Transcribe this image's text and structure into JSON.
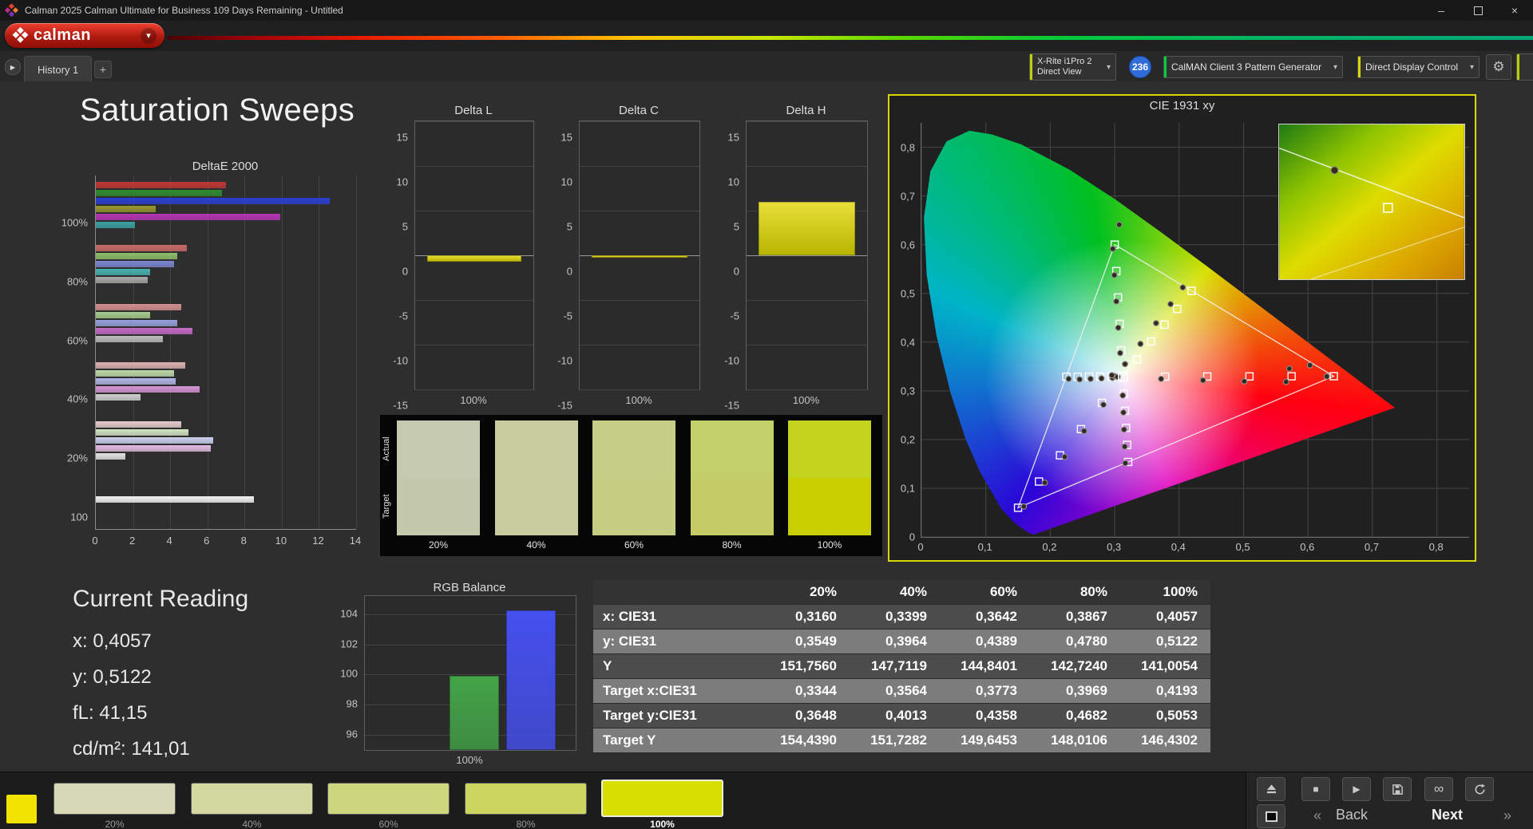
{
  "window": {
    "title": "Calman 2025 Calman Ultimate for Business 109 Days Remaining  - Untitled",
    "controls": {
      "minimize": "–",
      "close": "×"
    }
  },
  "brand": {
    "name": "calman",
    "menu_arrow": "▾"
  },
  "tabs": {
    "collapse": "▶",
    "history": "History 1",
    "add": "+"
  },
  "devices": {
    "meter": {
      "line1": "X-Rite i1Pro 2",
      "line2": "Direct View",
      "arrow": "▾",
      "accent": "#bfd100"
    },
    "badge": "236",
    "source": {
      "label": "CalMAN Client 3 Pattern Generator",
      "arrow": "▾",
      "accent": "#00d23c"
    },
    "display": {
      "label": "Direct Display Control",
      "arrow": "▾",
      "accent": "#d6d800"
    },
    "settings_icon": "⚙"
  },
  "page": {
    "title": "Saturation Sweeps"
  },
  "icons": {
    "stop": "■",
    "play": "▶",
    "infinity": "∞",
    "back_chevron": "«",
    "next_chevron": "»"
  },
  "charts": {
    "deltae": {
      "type": "bar",
      "title": "DeltaE 2000",
      "xlabel": "",
      "ylabel": "",
      "xlim": [
        0,
        14
      ],
      "xticks": [
        0,
        2,
        4,
        6,
        8,
        10,
        12,
        14
      ],
      "groups": [
        {
          "label": "100%",
          "bars": [
            {
              "color": "#c03636",
              "value": 7.0
            },
            {
              "color": "#2f8b2f",
              "value": 6.8
            },
            {
              "color": "#2b3fd0",
              "value": 12.6
            },
            {
              "color": "#96962e",
              "value": 3.2
            },
            {
              "color": "#b535b5",
              "value": 9.9
            },
            {
              "color": "#3aa0a0",
              "value": 2.1
            }
          ]
        },
        {
          "label": "80%",
          "bars": [
            {
              "color": "#cc6a6a",
              "value": 4.9
            },
            {
              "color": "#8fbf6a",
              "value": 4.4
            },
            {
              "color": "#7a86d0",
              "value": 4.2
            },
            {
              "color": "#49b0b0",
              "value": 2.9
            },
            {
              "color": "#a8a8a8",
              "value": 2.8
            }
          ]
        },
        {
          "label": "60%",
          "bars": [
            {
              "color": "#d29090",
              "value": 4.6
            },
            {
              "color": "#a6cc8d",
              "value": 2.9
            },
            {
              "color": "#97a0dd",
              "value": 4.4
            },
            {
              "color": "#c46ac4",
              "value": 5.2
            },
            {
              "color": "#bcbcbc",
              "value": 3.6
            }
          ]
        },
        {
          "label": "40%",
          "bars": [
            {
              "color": "#dcb0b0",
              "value": 4.8
            },
            {
              "color": "#bcd8a8",
              "value": 4.2
            },
            {
              "color": "#b0b6e6",
              "value": 4.3
            },
            {
              "color": "#d494d4",
              "value": 5.6
            },
            {
              "color": "#cfcfcf",
              "value": 2.4
            }
          ]
        },
        {
          "label": "20%",
          "bars": [
            {
              "color": "#e6cccc",
              "value": 4.6
            },
            {
              "color": "#d2e6c4",
              "value": 5.0
            },
            {
              "color": "#ccd0ee",
              "value": 6.3
            },
            {
              "color": "#e2bce2",
              "value": 6.2
            },
            {
              "color": "#e3e3e3",
              "value": 1.6
            }
          ]
        },
        {
          "label": "100",
          "bars": [
            {
              "color": "#f2f2f2",
              "value": 8.5
            }
          ]
        }
      ]
    },
    "delta_l": {
      "type": "bar",
      "title": "Delta L",
      "value": -0.7,
      "ylim": [
        -15,
        15
      ],
      "yticks": [
        15,
        10,
        5,
        0,
        -5,
        -10,
        -15
      ],
      "xlabel": "100%",
      "bar_color": "#d6d200"
    },
    "delta_c": {
      "type": "bar",
      "title": "Delta C",
      "value": -0.3,
      "ylim": [
        -15,
        15
      ],
      "yticks": [
        15,
        10,
        5,
        0,
        -5,
        -10,
        -15
      ],
      "xlabel": "100%",
      "bar_color": "#d6d200"
    },
    "delta_h": {
      "type": "bar",
      "title": "Delta H",
      "value": 6.0,
      "ylim": [
        -15,
        15
      ],
      "yticks": [
        15,
        10,
        5,
        0,
        -5,
        -10,
        -15
      ],
      "xlabel": "100%",
      "bar_color": "#d6d200"
    },
    "swatch_compare": {
      "row_labels": [
        "Actual",
        "Target"
      ],
      "columns": [
        "20%",
        "40%",
        "60%",
        "80%",
        "100%"
      ],
      "actual": [
        "#c6cab1",
        "#c8cda0",
        "#c4ce84",
        "#c3cf6b",
        "#c4d41e"
      ],
      "target": [
        "#c5c9ac",
        "#c9cc9c",
        "#c6cc82",
        "#c5cc66",
        "#c9cf00"
      ]
    },
    "rgb_balance": {
      "type": "bar",
      "title": "RGB Balance",
      "ylim": [
        95,
        105.2
      ],
      "yticks": [
        104,
        102,
        100,
        98,
        96
      ],
      "xlabel": "100%",
      "bars": [
        {
          "name": "green",
          "value": 99.9,
          "color": "#43a447"
        },
        {
          "name": "blue",
          "value": 104.25,
          "color": "#4550ef"
        }
      ]
    },
    "cie": {
      "type": "scatter",
      "title": "CIE 1931 xy",
      "xmax": 0.85,
      "ymax": 0.85,
      "ticks": [
        0,
        0.1,
        0.2,
        0.3,
        0.4,
        0.5,
        0.6,
        0.7,
        0.8
      ],
      "tick_labels": [
        "0",
        "0,1",
        "0,2",
        "0,3",
        "0,4",
        "0,5",
        "0,6",
        "0,7",
        "0,8"
      ],
      "white_point": [
        0.3127,
        0.329
      ],
      "triangle": [
        [
          0.64,
          0.33
        ],
        [
          0.3,
          0.6
        ],
        [
          0.15,
          0.06
        ]
      ],
      "locus": [
        [
          0.1741,
          0.005
        ],
        [
          0.166,
          0.009
        ],
        [
          0.1566,
          0.0177
        ],
        [
          0.144,
          0.0297
        ],
        [
          0.1241,
          0.0578
        ],
        [
          0.0913,
          0.1327
        ],
        [
          0.0687,
          0.2007
        ],
        [
          0.0454,
          0.295
        ],
        [
          0.0235,
          0.4127
        ],
        [
          0.0082,
          0.5384
        ],
        [
          0.0039,
          0.6548
        ],
        [
          0.0139,
          0.7502
        ],
        [
          0.0389,
          0.812
        ],
        [
          0.0743,
          0.8338
        ],
        [
          0.1096,
          0.8262
        ],
        [
          0.1547,
          0.8059
        ],
        [
          0.2296,
          0.7543
        ],
        [
          0.3016,
          0.6923
        ],
        [
          0.3731,
          0.6245
        ],
        [
          0.4441,
          0.5547
        ],
        [
          0.5125,
          0.4866
        ],
        [
          0.5752,
          0.4242
        ],
        [
          0.627,
          0.3725
        ],
        [
          0.6658,
          0.334
        ],
        [
          0.6915,
          0.3083
        ],
        [
          0.7079,
          0.292
        ],
        [
          0.7347,
          0.2653
        ]
      ],
      "target_squares": [
        [
          0.3782,
          0.3292
        ],
        [
          0.4436,
          0.3294
        ],
        [
          0.5091,
          0.3296
        ],
        [
          0.5745,
          0.3298
        ],
        [
          0.64,
          0.33
        ],
        [
          0.3102,
          0.3832
        ],
        [
          0.3076,
          0.4374
        ],
        [
          0.3051,
          0.4916
        ],
        [
          0.3025,
          0.5458
        ],
        [
          0.3,
          0.6
        ],
        [
          0.2802,
          0.2752
        ],
        [
          0.2476,
          0.2214
        ],
        [
          0.2151,
          0.1676
        ],
        [
          0.1825,
          0.1138
        ],
        [
          0.15,
          0.06
        ],
        [
          0.3344,
          0.3648
        ],
        [
          0.3564,
          0.4013
        ],
        [
          0.3773,
          0.4358
        ],
        [
          0.3969,
          0.4682
        ],
        [
          0.4193,
          0.5053
        ],
        [
          0.2952,
          0.329
        ],
        [
          0.2776,
          0.329
        ],
        [
          0.2601,
          0.329
        ],
        [
          0.2425,
          0.329
        ],
        [
          0.225,
          0.329
        ],
        [
          0.3143,
          0.294
        ],
        [
          0.316,
          0.259
        ],
        [
          0.3176,
          0.224
        ],
        [
          0.3193,
          0.189
        ],
        [
          0.3209,
          0.154
        ]
      ],
      "measured_circles": [
        [
          0.372,
          0.3245
        ],
        [
          0.437,
          0.3215
        ],
        [
          0.501,
          0.3195
        ],
        [
          0.566,
          0.3185
        ],
        [
          0.629,
          0.3295
        ],
        [
          0.571,
          0.3455
        ],
        [
          0.603,
          0.3525
        ],
        [
          0.3085,
          0.3775
        ],
        [
          0.3055,
          0.4295
        ],
        [
          0.3025,
          0.4835
        ],
        [
          0.2995,
          0.5375
        ],
        [
          0.297,
          0.5915
        ],
        [
          0.307,
          0.641
        ],
        [
          0.2825,
          0.2715
        ],
        [
          0.2525,
          0.2175
        ],
        [
          0.2225,
          0.1645
        ],
        [
          0.1915,
          0.1115
        ],
        [
          0.159,
          0.0625
        ],
        [
          0.316,
          0.3549
        ],
        [
          0.3399,
          0.3964
        ],
        [
          0.3642,
          0.4389
        ],
        [
          0.3867,
          0.478
        ],
        [
          0.4057,
          0.5122
        ],
        [
          0.2965,
          0.3265
        ],
        [
          0.2795,
          0.3255
        ],
        [
          0.2625,
          0.3245
        ],
        [
          0.2455,
          0.3235
        ],
        [
          0.2285,
          0.3245
        ],
        [
          0.3125,
          0.2905
        ],
        [
          0.3135,
          0.2555
        ],
        [
          0.3145,
          0.2205
        ],
        [
          0.3155,
          0.1855
        ],
        [
          0.3165,
          0.1515
        ],
        [
          0.2995,
          0.3305
        ],
        [
          0.3045,
          0.3285
        ],
        [
          0.2955,
          0.332
        ]
      ],
      "inset_colors": [
        "#1e7a14",
        "#8fc400",
        "#dedc00",
        "#dca800",
        "#c88000"
      ]
    }
  },
  "current_reading": {
    "title": "Current Reading",
    "x": "x: 0,4057",
    "y": "y: 0,5122",
    "fl": "fL: 41,15",
    "cdm2": "cd/m²: 141,01"
  },
  "table": {
    "columns": [
      "20%",
      "40%",
      "60%",
      "80%",
      "100%"
    ],
    "rows": [
      {
        "label": "x: CIE31",
        "values": [
          "0,3160",
          "0,3399",
          "0,3642",
          "0,3867",
          "0,4057"
        ]
      },
      {
        "label": "y: CIE31",
        "values": [
          "0,3549",
          "0,3964",
          "0,4389",
          "0,4780",
          "0,5122"
        ]
      },
      {
        "label": "Y",
        "values": [
          "151,7560",
          "147,7119",
          "144,8401",
          "142,7240",
          "141,0054"
        ]
      },
      {
        "label": "Target x:CIE31",
        "values": [
          "0,3344",
          "0,3564",
          "0,3773",
          "0,3969",
          "0,4193"
        ]
      },
      {
        "label": "Target y:CIE31",
        "values": [
          "0,3648",
          "0,4013",
          "0,4358",
          "0,4682",
          "0,5053"
        ]
      },
      {
        "label": "Target Y",
        "values": [
          "154,4390",
          "151,7282",
          "149,6453",
          "148,0106",
          "146,4302"
        ]
      }
    ]
  },
  "bottom": {
    "current_color": "#f2e400",
    "swatches": [
      {
        "label": "20%",
        "color": "#d6d8b6",
        "selected": false
      },
      {
        "label": "40%",
        "color": "#d3d7a0",
        "selected": false
      },
      {
        "label": "60%",
        "color": "#ced57f",
        "selected": false
      },
      {
        "label": "80%",
        "color": "#ccd55f",
        "selected": false
      },
      {
        "label": "100%",
        "color": "#d8de00",
        "selected": true
      }
    ],
    "back": "Back",
    "next": "Next"
  }
}
